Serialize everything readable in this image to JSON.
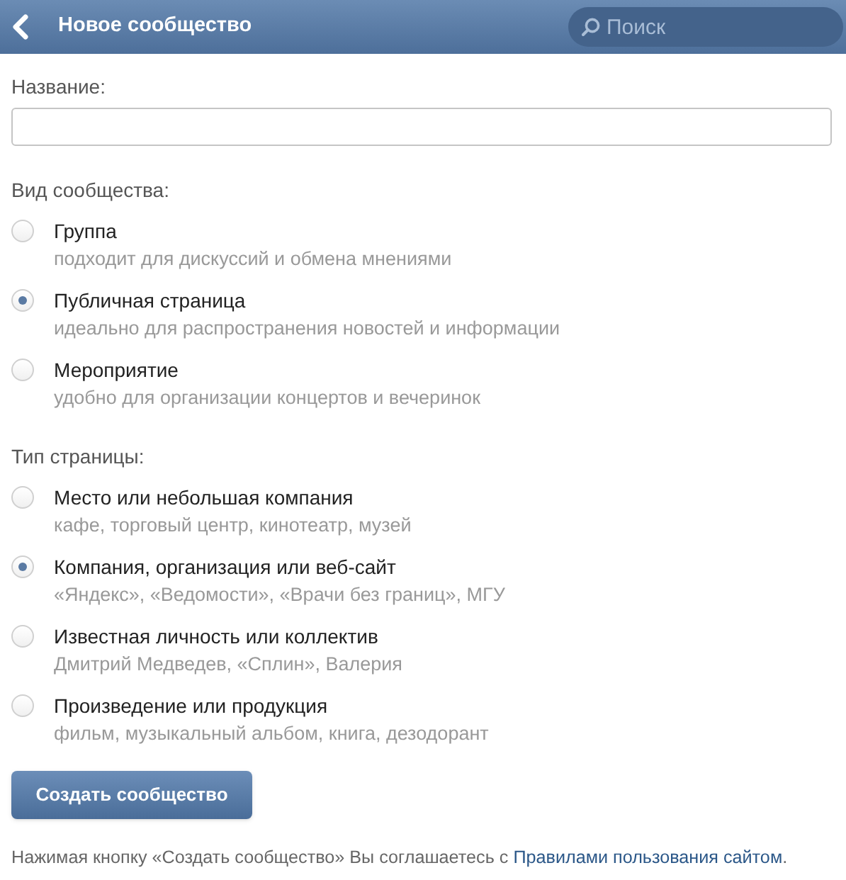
{
  "header": {
    "title": "Новое сообщество",
    "search": {
      "placeholder": "Поиск"
    }
  },
  "name_field": {
    "label": "Название:"
  },
  "sections": [
    {
      "label": "Вид сообщества:",
      "options": [
        {
          "title": "Группа",
          "subtitle": "подходит для дискуссий и обмена мнениями",
          "selected": false
        },
        {
          "title": "Публичная страница",
          "subtitle": "идеально для распространения новостей и информации",
          "selected": true
        },
        {
          "title": "Мероприятие",
          "subtitle": "удобно для организации концертов и вечеринок",
          "selected": false
        }
      ]
    },
    {
      "label": "Тип страницы:",
      "options": [
        {
          "title": "Место или небольшая компания",
          "subtitle": "кафе, торговый центр, кинотеатр, музей",
          "selected": false
        },
        {
          "title": "Компания, организация или веб-сайт",
          "subtitle": "«Яндекс», «Ведомости», «Врачи без границ», МГУ",
          "selected": true
        },
        {
          "title": "Известная личность или коллектив",
          "subtitle": "Дмитрий Медведев, «Сплин», Валерия",
          "selected": false
        },
        {
          "title": "Произведение или продукция",
          "subtitle": "фильм, музыкальный альбом, книга, дезодорант",
          "selected": false
        }
      ]
    }
  ],
  "create_button": "Создать сообщество",
  "footer": {
    "text": "Нажимая кнопку «Создать сообщество» Вы соглашаетесь с",
    "link": "Правилами пользования сайтом",
    "end": "."
  }
}
